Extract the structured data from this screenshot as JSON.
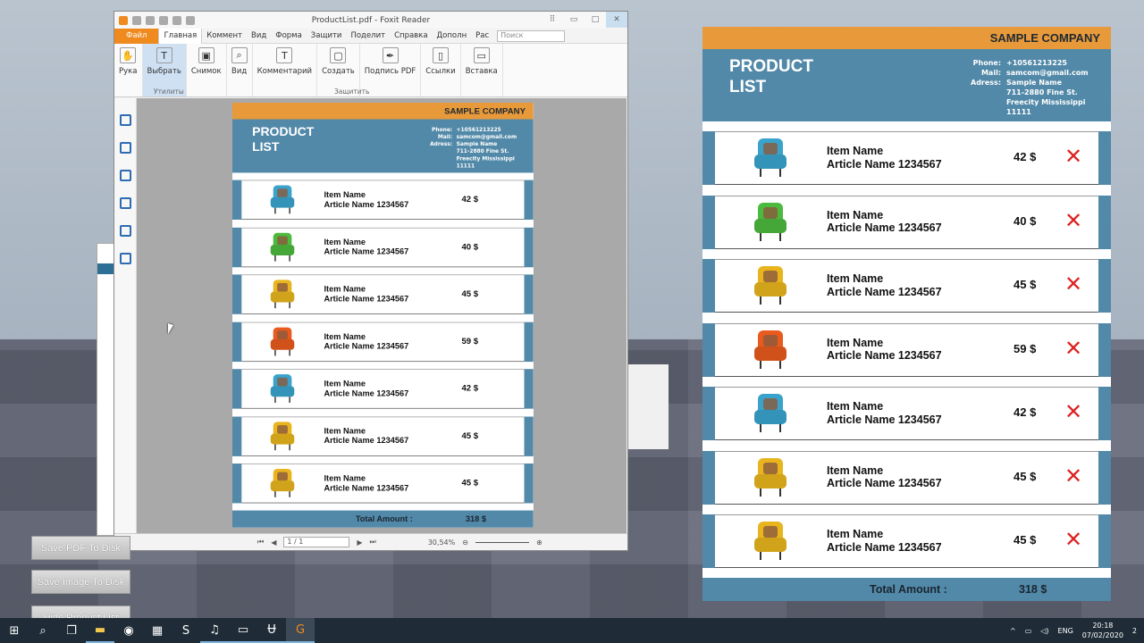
{
  "window": {
    "title": "ProductList.pdf - Foxit Reader",
    "menu": [
      "Файл",
      "Главная",
      "Коммент",
      "Вид",
      "Форма",
      "Защити",
      "Поделит",
      "Справка",
      "Дополн"
    ],
    "tell_me": "Рас",
    "search_placeholder": "Поиск",
    "ribbon": [
      {
        "label": "Рука",
        "icon": "hand-icon"
      },
      {
        "label": "Выбрать",
        "icon": "select-text-icon"
      },
      {
        "label": "Снимок",
        "icon": "snapshot-icon"
      },
      {
        "label": "Вид",
        "icon": "view-zoom-icon"
      },
      {
        "label": "Комментарий",
        "icon": "comment-icon"
      },
      {
        "label": "Создать",
        "icon": "create-icon"
      },
      {
        "label": "Подпись PDF",
        "icon": "sign-pen-icon"
      },
      {
        "label": "Ссылки",
        "icon": "links-icon"
      },
      {
        "label": "Вставка",
        "icon": "insert-icon"
      }
    ],
    "groups": {
      "utilities": "Утилиты",
      "protect": "Защитить"
    },
    "status": {
      "page": "1 / 1",
      "zoom": "30,54%"
    }
  },
  "product_list": {
    "company": "SAMPLE COMPANY",
    "title_line1": "PRODUCT",
    "title_line2": "LIST",
    "info": [
      {
        "k": "Phone:",
        "v": "+10561213225"
      },
      {
        "k": "Mail:",
        "v": "samcom@gmail.com"
      },
      {
        "k": "Adress:",
        "v": "Sample Name"
      },
      {
        "k": "",
        "v": "711-2880 Fine St."
      },
      {
        "k": "",
        "v": "Freecity Mississippi"
      },
      {
        "k": "",
        "v": "11111"
      }
    ],
    "items": [
      {
        "name": "Item Name",
        "article": "Article Name 1234567",
        "price": "42 $",
        "color": "#3aa3cc"
      },
      {
        "name": "Item Name",
        "article": "Article Name 1234567",
        "price": "40 $",
        "color": "#4cba3e"
      },
      {
        "name": "Item Name",
        "article": "Article Name 1234567",
        "price": "45 $",
        "color": "#e8b51e"
      },
      {
        "name": "Item Name",
        "article": "Article Name 1234567",
        "price": "59 $",
        "color": "#e85a1e"
      },
      {
        "name": "Item Name",
        "article": "Article Name 1234567",
        "price": "42 $",
        "color": "#3aa3cc"
      },
      {
        "name": "Item Name",
        "article": "Article Name 1234567",
        "price": "45 $",
        "color": "#e8b51e"
      },
      {
        "name": "Item Name",
        "article": "Article Name 1234567",
        "price": "45 $",
        "color": "#e8b51e"
      }
    ],
    "remove_symbol": "✕",
    "total_label": "Total Amount :",
    "total_value": "318 $"
  },
  "buttons": {
    "save_pdf": "Save PDF To Disk",
    "save_image": "Save Image To Disk",
    "hide_list": "Hide Product List"
  },
  "taskbar": {
    "apps": [
      "start-icon",
      "search-icon",
      "task-view-icon",
      "file-explorer-icon",
      "chrome-icon",
      "calculator-icon",
      "skype-icon",
      "itunes-icon",
      "app-icon",
      "unreal-engine-icon",
      "foxit-reader-icon"
    ],
    "lang": "ENG",
    "time": "20:18",
    "date": "07/02/2020",
    "notifications": "2"
  }
}
